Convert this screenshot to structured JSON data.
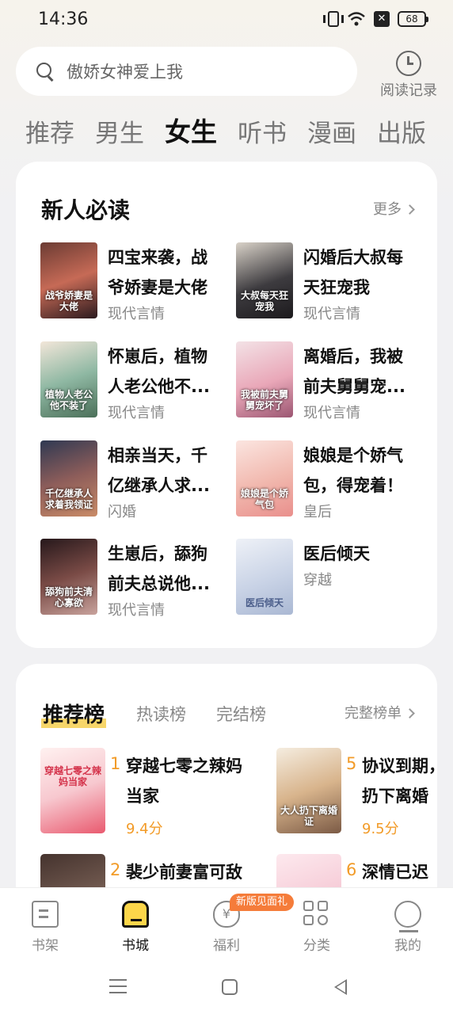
{
  "status_bar": {
    "time": "14:36",
    "battery": "68",
    "sim_label": "✕"
  },
  "search": {
    "placeholder": "傲娇女神爱上我"
  },
  "history": {
    "label": "阅读记录"
  },
  "tabs": [
    {
      "label": "推荐"
    },
    {
      "label": "男生"
    },
    {
      "label": "女生",
      "active": true
    },
    {
      "label": "听书"
    },
    {
      "label": "漫画"
    },
    {
      "label": "出版"
    }
  ],
  "new_reads": {
    "title": "新人必读",
    "more_label": "更多",
    "books": [
      {
        "title": "四宝来袭，战爷娇妻是大佬",
        "display_title": "四宝来袭，战\n爷娇妻是大佬",
        "tag": "现代言情",
        "cover_text": "战爷娇妻是大佬"
      },
      {
        "title": "闪婚后大叔每天狂宠我",
        "display_title": "闪婚后大叔每\n天狂宠我",
        "tag": "现代言情",
        "cover_text": "大叔每天狂宠我"
      },
      {
        "title": "怀崽后，植物人老公他不...",
        "display_title": "怀崽后，植物\n人老公他不...",
        "tag": "现代言情",
        "cover_text": "植物人老公他不装了"
      },
      {
        "title": "离婚后，我被前夫舅舅宠...",
        "display_title": "离婚后，我被\n前夫舅舅宠...",
        "tag": "现代言情",
        "cover_text": "我被前夫舅舅宠坏了"
      },
      {
        "title": "相亲当天，千亿继承人求...",
        "display_title": "相亲当天，千\n亿继承人求...",
        "tag": "闪婚",
        "cover_text": "千亿继承人求着我领证"
      },
      {
        "title": "娘娘是个娇气包，得宠着！",
        "display_title": "娘娘是个娇气\n包，得宠着！",
        "tag": "皇后",
        "cover_text": "娘娘是个娇气包"
      },
      {
        "title": "生崽后，舔狗前夫总说他...",
        "display_title": "生崽后，舔狗\n前夫总说他...",
        "tag": "现代言情",
        "cover_text": "舔狗前夫清心寡欲"
      },
      {
        "title": "医后倾天",
        "display_title": "医后倾天",
        "tag": "穿越",
        "cover_text": "医后倾天"
      }
    ]
  },
  "ranking": {
    "tabs": [
      {
        "label": "推荐榜",
        "active": true
      },
      {
        "label": "热读榜"
      },
      {
        "label": "完结榜"
      }
    ],
    "full_label": "完整榜单",
    "items": [
      {
        "rank": "1",
        "title": "穿越七零之辣妈当家",
        "display_title": "穿越七零之辣妈\n当家",
        "score": "9.4分",
        "cover_text": "穿越七零之辣妈当家"
      },
      {
        "rank": "5",
        "title": "协议到期，扔下离婚",
        "display_title": "协议到期，\n扔下离婚",
        "score": "9.5分",
        "cover_text": "大人扔下离婚证"
      },
      {
        "rank": "2",
        "title": "裴少前妻富可敌",
        "display_title": "裴少前妻富可敌",
        "score": "",
        "cover_text": ""
      },
      {
        "rank": "6",
        "title": "深情已迟",
        "display_title": "深情已迟",
        "score": "",
        "cover_text": ""
      }
    ]
  },
  "bottom_nav": [
    {
      "label": "书架",
      "icon": "bookshelf-icon"
    },
    {
      "label": "书城",
      "icon": "bookstore-icon",
      "active": true
    },
    {
      "label": "福利",
      "icon": "welfare-icon"
    },
    {
      "label": "分类",
      "icon": "category-icon"
    },
    {
      "label": "我的",
      "icon": "profile-icon"
    }
  ],
  "promo_badge": "新版见面礼",
  "colors": {
    "accent": "#f29b28",
    "highlight": "#f7d66a",
    "badge": "#f57c3a"
  }
}
